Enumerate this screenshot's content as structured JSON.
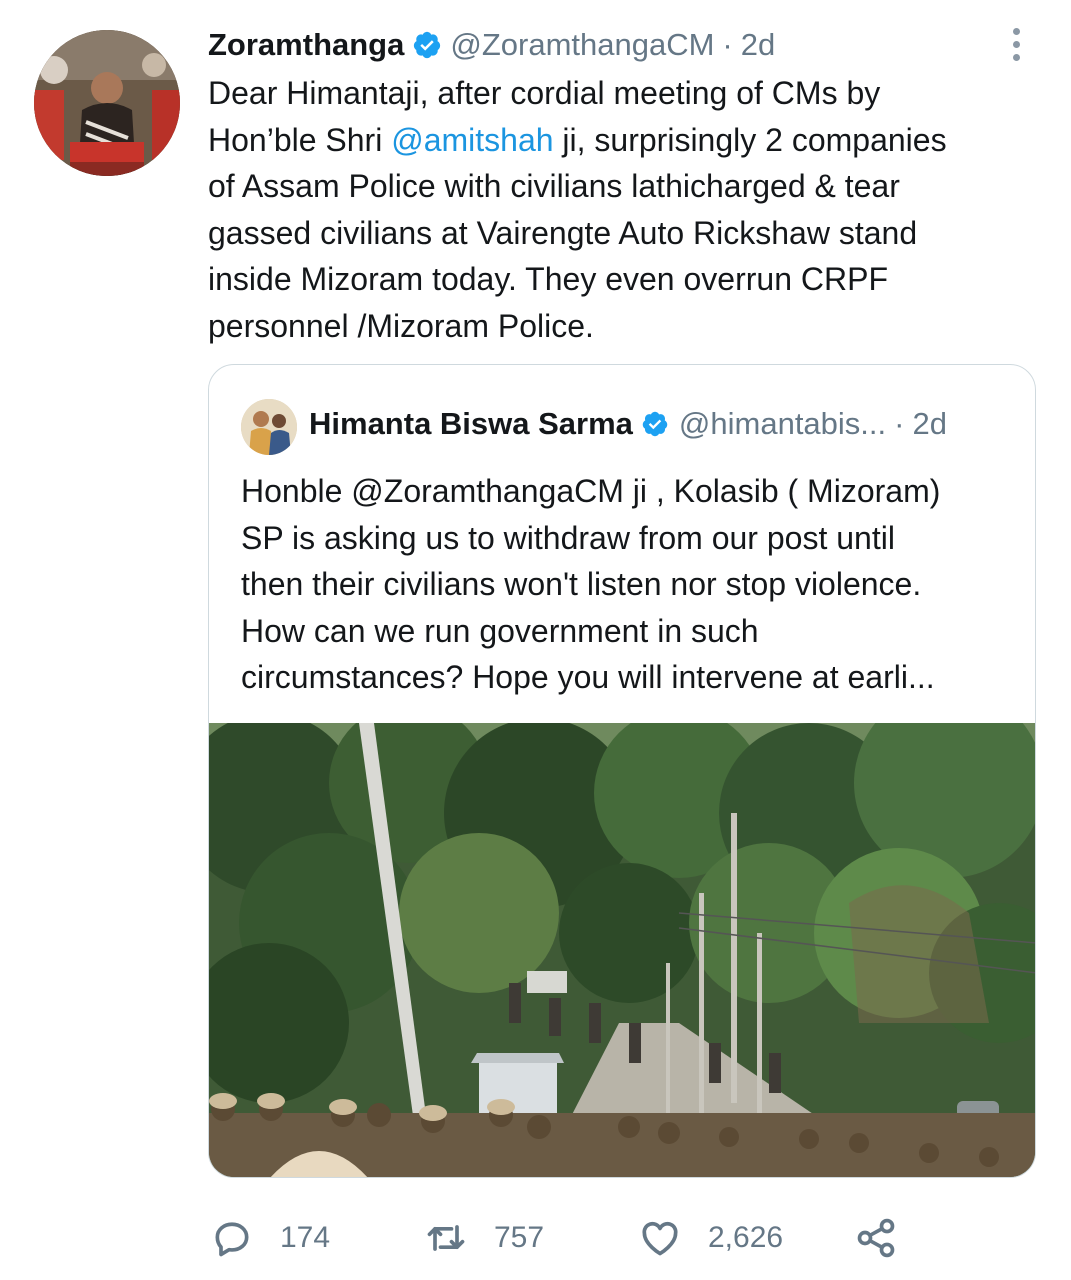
{
  "tweet": {
    "author_name": "Zoramthanga",
    "author_handle": "@ZoramthangaCM",
    "separator": "·",
    "time": "2d",
    "text_lines": [
      "Dear Himantaji, after cordial meeting of CMs by",
      {
        "before": "Hon’ble Shri ",
        "mention": "@amitshah",
        "after": " ji, surprisingly 2 companies"
      },
      "of Assam Police with civilians lathicharged & tear",
      "gassed civilians at Vairengte Auto Rickshaw stand",
      "inside Mizoram today. They even overrun CRPF",
      "personnel /Mizoram Police."
    ]
  },
  "quoted_tweet": {
    "author_name": "Himanta Biswa Sarma",
    "author_handle": "@himantabis...",
    "separator": "·",
    "time": "2d",
    "text_lines": [
      "Honble @ZoramthangaCM ji , Kolasib ( Mizoram)",
      "SP is asking us to withdraw from our post until",
      "then their civilians won't listen nor stop violence.",
      "How can we run government in such",
      "circumstances? Hope you will intervene at earli..."
    ]
  },
  "actions": {
    "reply_count": "174",
    "retweet_count": "757",
    "like_count": "2,626"
  },
  "icons": {
    "verified": "verified-badge-icon",
    "more": "more-options-icon",
    "reply": "reply-icon",
    "retweet": "retweet-icon",
    "like": "heart-icon",
    "share": "share-icon"
  },
  "colors": {
    "verified_blue": "#1da1f2",
    "mention_blue": "#1b95e0",
    "secondary_text": "#657786",
    "border": "#cfd9de"
  }
}
